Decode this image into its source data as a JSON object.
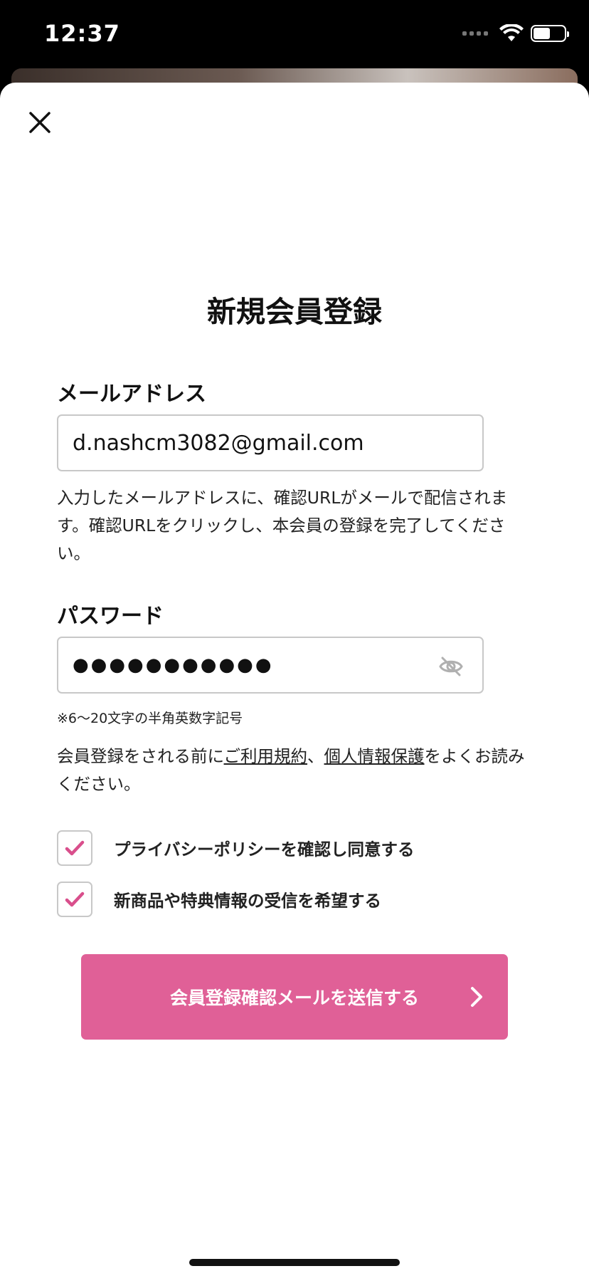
{
  "status_bar": {
    "time": "12:37"
  },
  "modal": {
    "title": "新規会員登録",
    "email": {
      "label": "メールアドレス",
      "value": "d.nashcm3082@gmail.com",
      "help": "入力したメールアドレスに、確認URLがメールで配信されます。確認URLをクリックし、本会員の登録を完了してください。"
    },
    "password": {
      "label": "パスワード",
      "masked_value": "●●●●●●●●●●●",
      "hint": "※6〜20文字の半角英数字記号"
    },
    "terms": {
      "prefix": "会員登録をされる前に",
      "link1": "ご利用規約",
      "sep": "、",
      "link2": "個人情報保護",
      "suffix": "をよくお読みください。"
    },
    "checkboxes": [
      {
        "label": "プライバシーポリシーを確認し同意する",
        "checked": true
      },
      {
        "label": "新商品や特典情報の受信を希望する",
        "checked": true
      }
    ],
    "submit_label": "会員登録確認メールを送信する"
  },
  "colors": {
    "accent": "#e06097",
    "check": "#d94f8c",
    "border": "#c8c8c8"
  },
  "icons": [
    "close-icon",
    "eye-off-icon",
    "check-icon",
    "chevron-right-icon",
    "wifi-icon",
    "battery-icon"
  ]
}
